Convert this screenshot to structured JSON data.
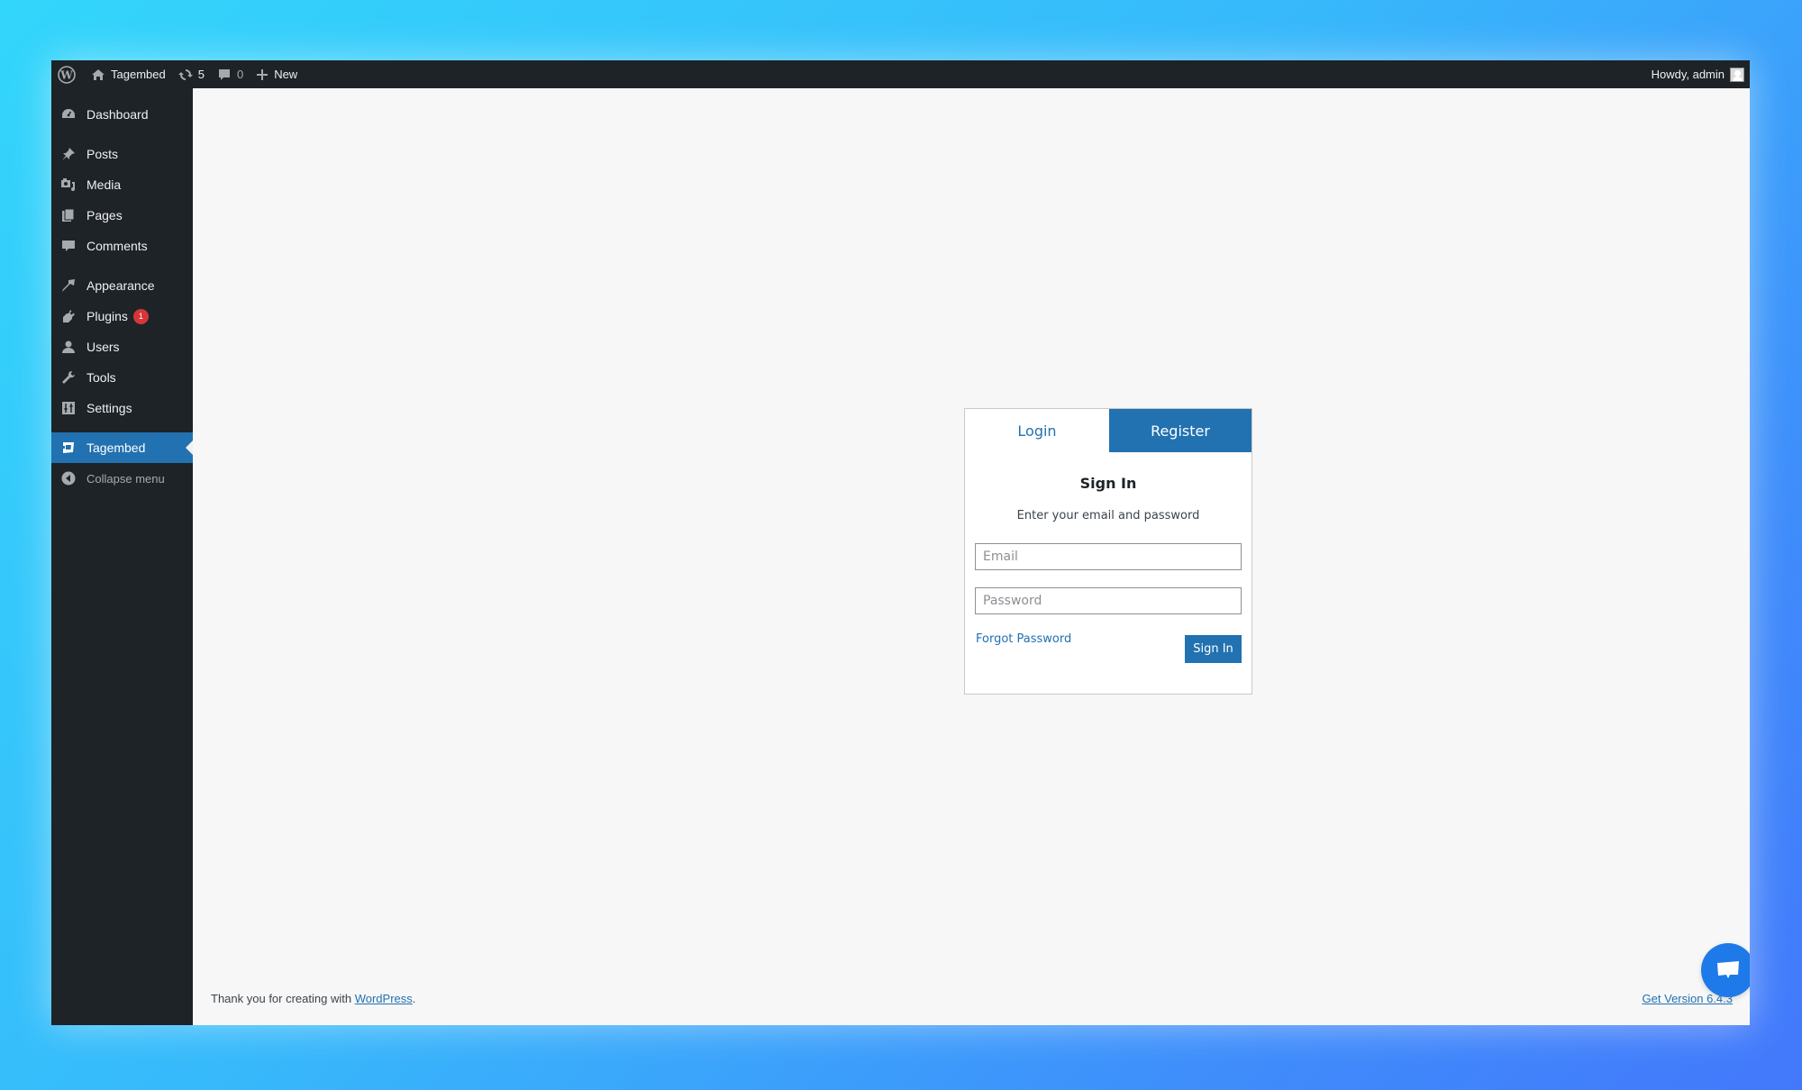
{
  "adminbar": {
    "site_name": "Tagembed",
    "updates_count": "5",
    "comments_count": "0",
    "new_label": "New",
    "greeting": "Howdy, admin"
  },
  "sidebar": {
    "items": [
      {
        "label": "Dashboard",
        "icon": "dashboard-icon"
      },
      {
        "label": "Posts",
        "icon": "pin-icon"
      },
      {
        "label": "Media",
        "icon": "media-icon"
      },
      {
        "label": "Pages",
        "icon": "pages-icon"
      },
      {
        "label": "Comments",
        "icon": "comment-icon"
      },
      {
        "label": "Appearance",
        "icon": "paintbrush-icon"
      },
      {
        "label": "Plugins",
        "icon": "plug-icon",
        "badge": "1"
      },
      {
        "label": "Users",
        "icon": "user-icon"
      },
      {
        "label": "Tools",
        "icon": "wrench-icon"
      },
      {
        "label": "Settings",
        "icon": "settings-icon"
      },
      {
        "label": "Tagembed",
        "icon": "tagembed-icon",
        "active": true
      }
    ],
    "collapse_label": "Collapse menu"
  },
  "login_card": {
    "tabs": [
      {
        "label": "Login",
        "active": true
      },
      {
        "label": "Register",
        "active": false
      }
    ],
    "title": "Sign In",
    "subtitle": "Enter your email and password",
    "email_placeholder": "Email",
    "email_value": "",
    "password_placeholder": "Password",
    "password_value": "",
    "forgot_label": "Forgot Password",
    "submit_label": "Sign In"
  },
  "footer": {
    "thanks_text": "Thank you for creating with ",
    "wordpress_link": "WordPress",
    "thanks_suffix": ".",
    "version_link": "Get Version 6.4.3"
  },
  "colors": {
    "accent": "#2271b1",
    "adminbar_bg": "#1d2327",
    "badge": "#d63638",
    "chat_bubble": "#1e7ae8"
  }
}
